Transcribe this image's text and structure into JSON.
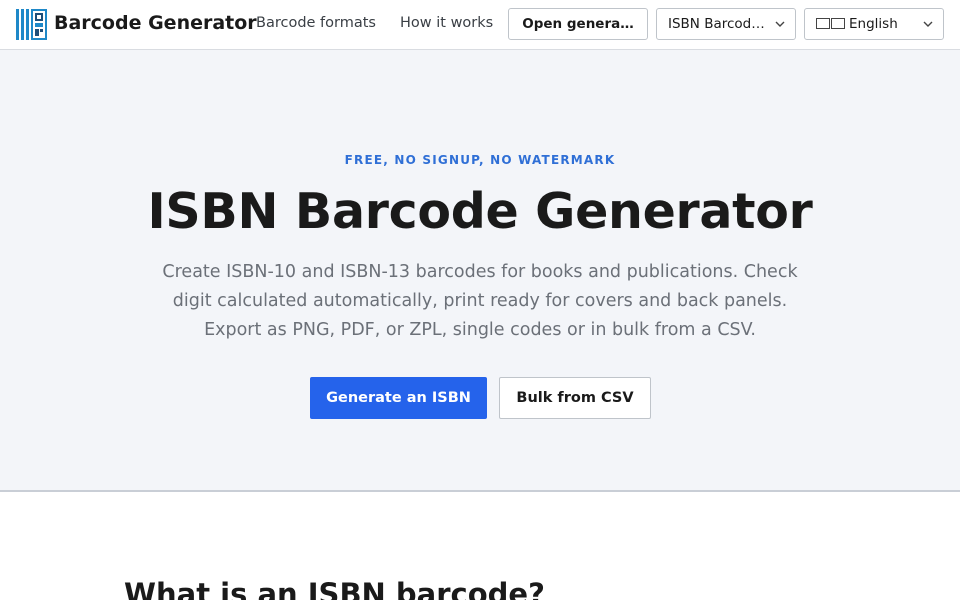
{
  "header": {
    "brand": "Barcode Generator",
    "nav": {
      "formats": "Barcode formats",
      "how": "How it works"
    },
    "open_generator": "Open genera…",
    "type_select": {
      "selected": "ISBN Barcod…"
    },
    "language_select": {
      "selected": "English"
    }
  },
  "hero": {
    "eyebrow": "FREE, NO SIGNUP, NO WATERMARK",
    "title": "ISBN Barcode Generator",
    "description": "Create ISBN-10 and ISBN-13 barcodes for books and publications. Check digit calculated automatically, print ready for covers and back panels. Export as PNG, PDF, or ZPL, single codes or in bulk from a CSV.",
    "primary_button": "Generate an ISBN",
    "secondary_button": "Bulk from CSV"
  },
  "section": {
    "heading": "What is an ISBN barcode?"
  },
  "colors": {
    "accent": "#2563eb",
    "eyebrow": "#2f6fd6",
    "hero_bg": "#f3f5f9",
    "logo": "#1e88c8"
  },
  "icons": [
    "barcode-logo-icon",
    "chevron-down-icon",
    "flag-icon"
  ]
}
